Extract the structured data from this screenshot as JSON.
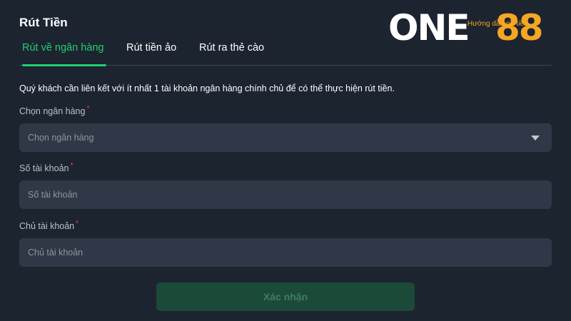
{
  "header": {
    "title": "Rút Tiền",
    "guide_link": "Hướng dẫn rút tiền"
  },
  "logo": {
    "text_left": "ONE",
    "text_right": "88",
    "color_left": "#ffffff",
    "color_right": "#f5a623"
  },
  "tabs": [
    {
      "label": "Rút về ngân hàng",
      "active": true
    },
    {
      "label": "Rút tiền ảo",
      "active": false
    },
    {
      "label": "Rút ra thẻ cào",
      "active": false
    }
  ],
  "notice": "Quý khách cần liên kết với ít nhất 1 tài khoản ngân hàng chính chủ để có thể thực hiện rút tiền.",
  "form": {
    "bank": {
      "label": "Chọn ngân hàng",
      "required_mark": "*",
      "placeholder": "Chọn ngân hàng"
    },
    "account_number": {
      "label": "Số tài khoản",
      "required_mark": "*",
      "placeholder": "Số tài khoản"
    },
    "account_holder": {
      "label": "Chủ tài khoản",
      "required_mark": "*",
      "placeholder": "Chủ tài khoản"
    },
    "submit_label": "Xác nhận"
  },
  "colors": {
    "background": "#1c2430",
    "field": "#2f3846",
    "accent": "#1fcf6e",
    "button_disabled": "#1b4a39"
  }
}
